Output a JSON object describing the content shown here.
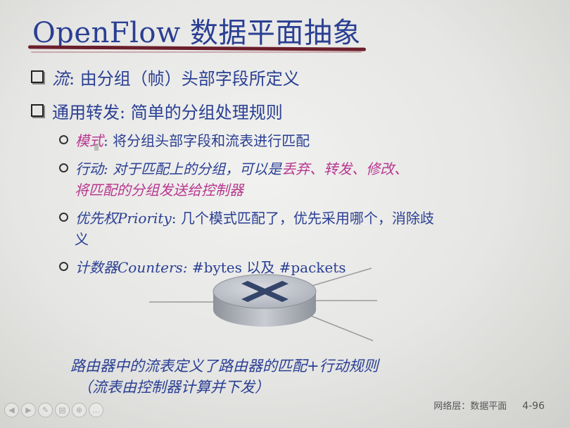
{
  "slide": {
    "title": "OpenFlow 数据平面抽象",
    "bullets": [
      {
        "label": "流",
        "text": ": 由分组（帧）头部字段所定义"
      },
      {
        "label": "通用转发",
        "text": ": 简单的分组处理规则"
      }
    ],
    "sub_items": {
      "pattern": {
        "label": "模式",
        "text": ": 将分组头部字段和流表进行匹配"
      },
      "action": {
        "label": "行动",
        "text": ": 对于匹配上的分组，可以是",
        "drop": "丢弃",
        "sep1": "、",
        "forward": "转发",
        "sep2": "、",
        "modify": "修改",
        "sep3": "、",
        "send_to_controller": "将匹配的分组发送给控制器"
      },
      "priority": {
        "label": "优先权",
        "label_en": "Priority",
        "text": ": 几个模式匹配了，优先采用哪个，消除歧",
        "text_cont": "义"
      },
      "counters": {
        "label": "计数器",
        "label_en": "Counters:",
        "text": " #bytes 以及 #packets"
      }
    },
    "caption_line1": "路由器中的流表定义了路由器的匹配+行动规则",
    "caption_line2": "（流表由控制器计算并下发）",
    "footer_section": "网络层：数据平面",
    "page_number": "4-96"
  },
  "nav_icons": [
    "nav-prev-icon",
    "nav-next-icon",
    "nav-pen-icon",
    "nav-menu-icon",
    "nav-zoom-icon",
    "nav-more-icon"
  ],
  "colors": {
    "title": "#2a3f93",
    "text": "#2a3f93",
    "emphasis": "#b8368f",
    "rule": "#6b1f2b"
  }
}
